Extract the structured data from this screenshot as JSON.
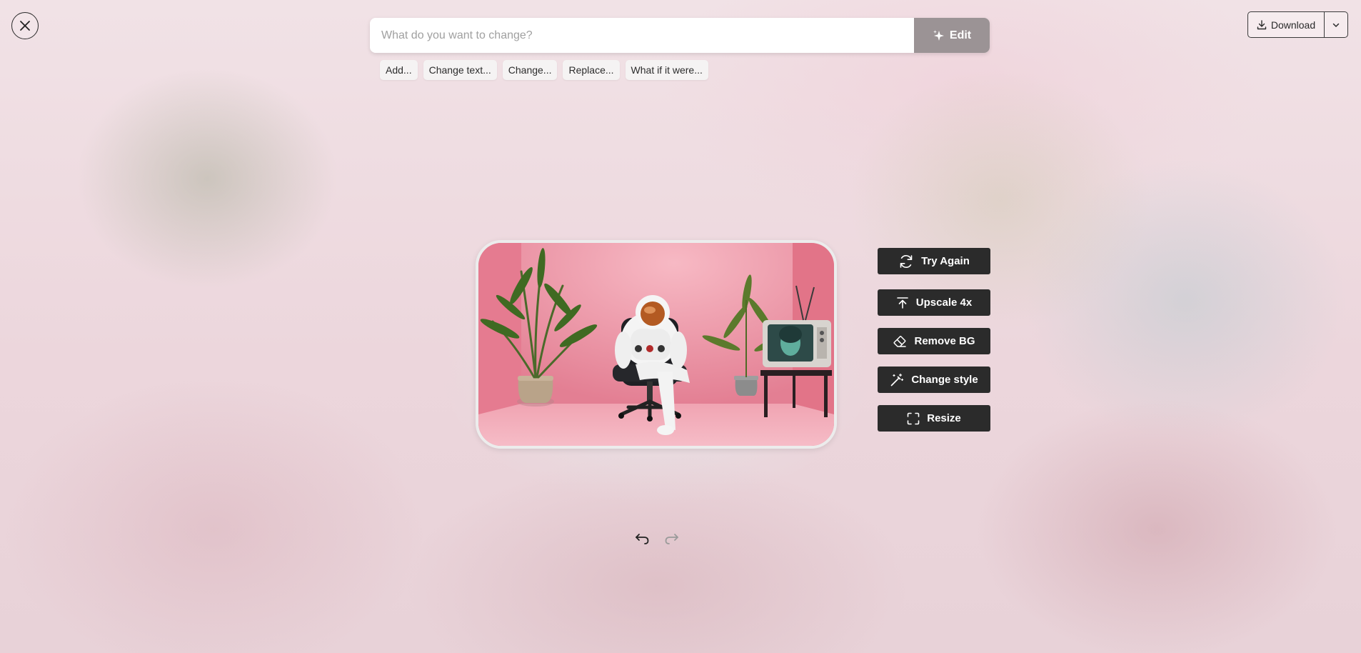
{
  "prompt": {
    "placeholder": "What do you want to change?",
    "value": "",
    "edit_label": "Edit"
  },
  "suggestions": [
    "Add...",
    "Change text...",
    "Change...",
    "Replace...",
    "What if it were..."
  ],
  "download": {
    "label": "Download"
  },
  "actions": [
    {
      "label": "Try Again",
      "icon": "refresh-icon"
    },
    {
      "label": "Upscale 4x",
      "icon": "upscale-icon"
    },
    {
      "label": "Remove BG",
      "icon": "eraser-icon"
    },
    {
      "label": "Change style",
      "icon": "magic-wand-icon"
    },
    {
      "label": "Resize",
      "icon": "resize-icon"
    }
  ],
  "history": {
    "undo_icon": "undo-icon",
    "redo_icon": "redo-icon"
  },
  "colors": {
    "action_bg": "#2b2b2b",
    "edit_bg": "#9b9395",
    "image_wall": "#e9889a"
  }
}
